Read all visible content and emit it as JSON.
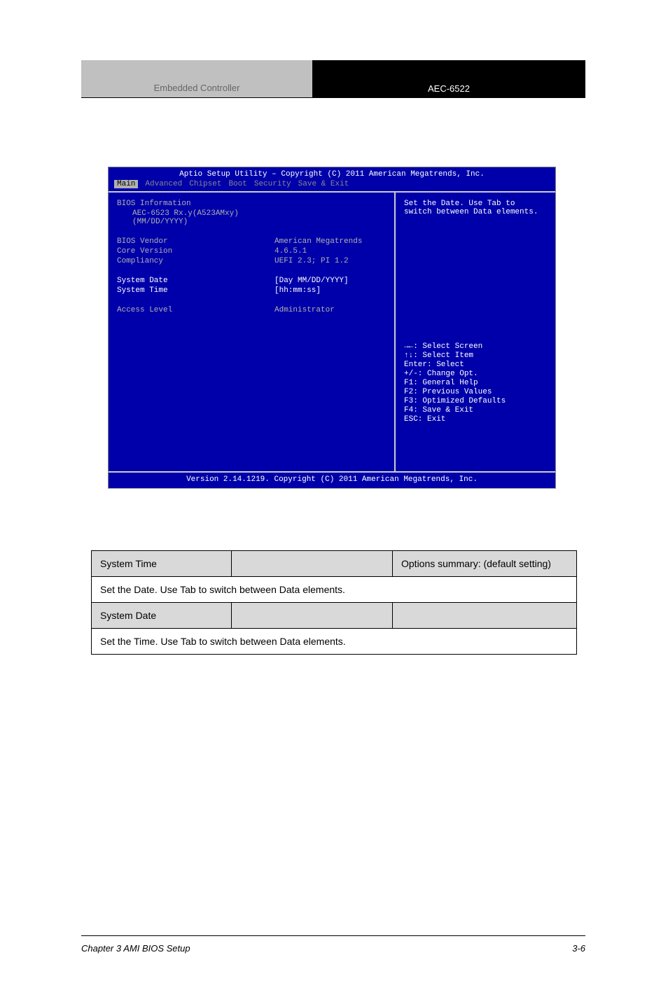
{
  "header": {
    "left": "Embedded Controller",
    "right": "AEC-6522"
  },
  "bios": {
    "title": "Aptio Setup Utility – Copyright (C) 2011 American Megatrends, Inc.",
    "menu": [
      "Main",
      "Advanced",
      "Chipset",
      "Boot",
      "Security",
      "Save & Exit"
    ],
    "info_section": "BIOS Information",
    "info_sub": "AEC-6523 Rx.y(A523AMxy) (MM/DD/YYYY)",
    "rows": [
      {
        "label": "BIOS Vendor",
        "value": "American Megatrends"
      },
      {
        "label": "Core Version",
        "value": "4.6.5.1"
      },
      {
        "label": "Compliancy",
        "value": "UEFI 2.3; PI 1.2"
      }
    ],
    "sel_rows": [
      {
        "label": "System Date",
        "value": "[Day MM/DD/YYYY]"
      },
      {
        "label": "System Time",
        "value": "[hh:mm:ss]"
      }
    ],
    "access_label": "Access Level",
    "access_value": "Administrator",
    "help_top1": "Set the Date. Use Tab to",
    "help_top2": "switch between Data elements.",
    "help_keys": [
      "→←: Select Screen",
      "↑↓: Select Item",
      "Enter: Select",
      "+/-: Change Opt.",
      "F1: General Help",
      "F2: Previous Values",
      "F3: Optimized Defaults",
      "F4: Save & Exit",
      "ESC: Exit"
    ],
    "footer": "Version 2.14.1219. Copyright (C) 2011 American Megatrends, Inc."
  },
  "table": {
    "h1": "System Time",
    "h2": "Options summary: (default setting)",
    "r1": "Set the Date. Use Tab to switch between Data elements.",
    "h3": "System Date",
    "r2": "Set the Time. Use Tab to switch between Data elements."
  },
  "footer": {
    "left": "Chapter 3 AMI BIOS Setup",
    "right": "3-6"
  }
}
